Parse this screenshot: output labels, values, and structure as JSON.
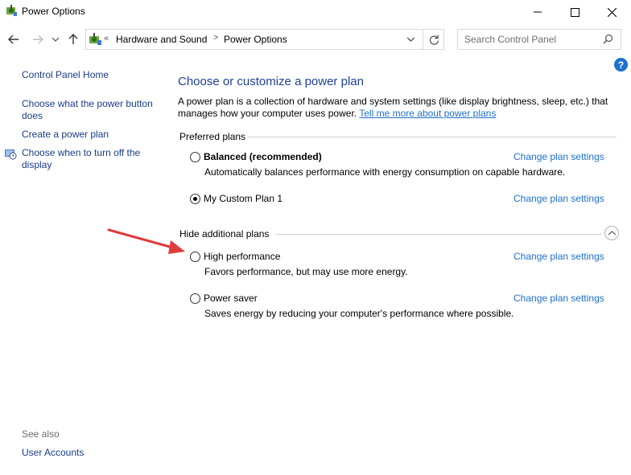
{
  "window": {
    "title": "Power Options"
  },
  "address": {
    "chevrons": "«",
    "crumbs": [
      "Hardware and Sound",
      "Power Options"
    ],
    "separator": ">"
  },
  "search": {
    "placeholder": "Search Control Panel"
  },
  "help": "?",
  "sidebar": {
    "home": "Control Panel Home",
    "items": [
      "Choose what the power button does",
      "Create a power plan",
      "Choose when to turn off the display"
    ],
    "see_also_label": "See also",
    "see_also_items": [
      "User Accounts"
    ]
  },
  "main": {
    "title": "Choose or customize a power plan",
    "description": "A power plan is a collection of hardware and system settings (like display brightness, sleep, etc.) that manages how your computer uses power.",
    "description_link": "Tell me more about power plans",
    "preferred_label": "Preferred plans",
    "hide_label": "Hide additional plans",
    "change_label": "Change plan settings",
    "plans": [
      {
        "name": "Balanced (recommended)",
        "desc": "Automatically balances performance with energy consumption on capable hardware.",
        "selected": false
      },
      {
        "name": "My Custom Plan 1",
        "desc": "",
        "selected": true
      },
      {
        "name": "High performance",
        "desc": "Favors performance, but may use more energy.",
        "selected": false
      },
      {
        "name": "Power saver",
        "desc": "Saves energy by reducing your computer's performance where possible.",
        "selected": false
      }
    ]
  },
  "icons": {
    "back": "arrow-left-icon",
    "forward": "arrow-right-icon",
    "recent": "chevron-down-icon",
    "up": "arrow-up-icon",
    "refresh": "refresh-icon",
    "search": "search-icon",
    "annotation": "red-arrow-icon"
  },
  "colors": {
    "link": "#1e6fcf",
    "title": "#1e3f9f",
    "annotation": "#e03c3c"
  }
}
